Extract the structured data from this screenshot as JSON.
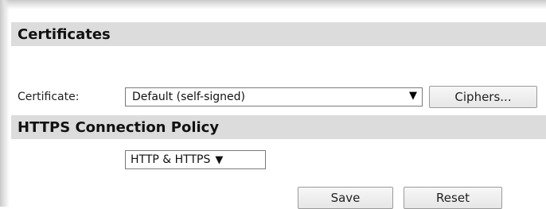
{
  "certificates": {
    "header": "Certificates",
    "certificate_label": "Certificate:",
    "certificate_value": "Default (self-signed)",
    "ciphers_button": "Ciphers..."
  },
  "https_policy": {
    "header": "HTTPS Connection Policy",
    "policy_value": "HTTP & HTTPS"
  },
  "actions": {
    "save_label": "Save",
    "reset_label": "Reset"
  },
  "icons": {
    "dropdown": "▼"
  }
}
